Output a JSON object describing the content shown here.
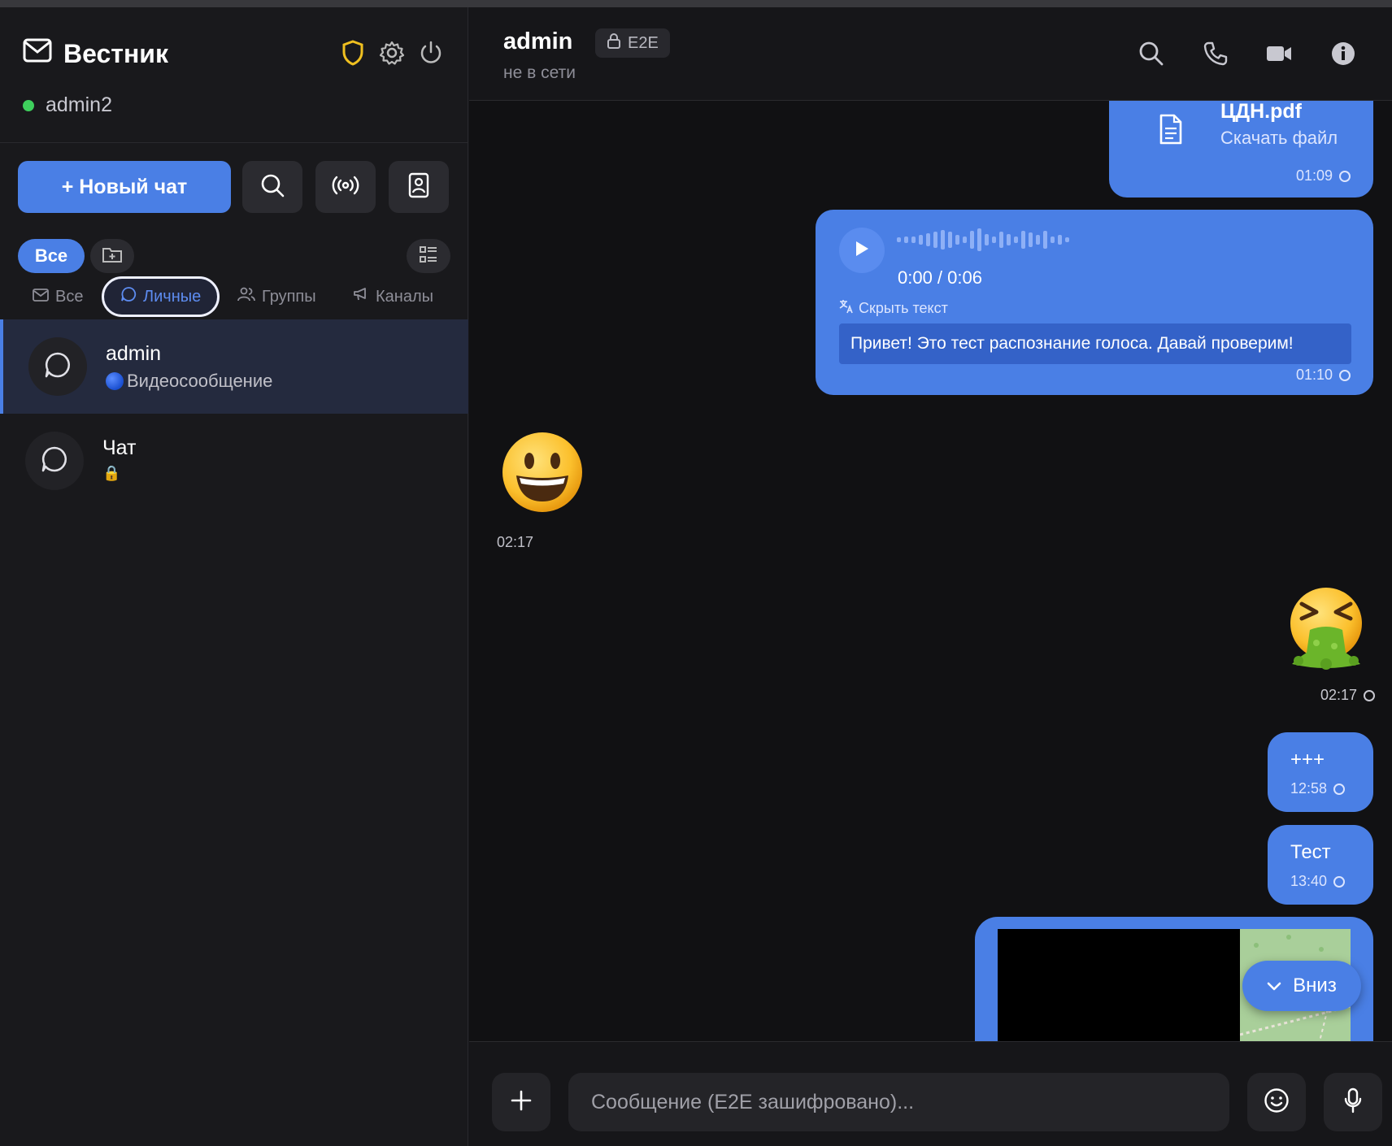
{
  "app": {
    "title": "Вестник",
    "user": "admin2"
  },
  "sidebar": {
    "new_chat": "+ Новый чат",
    "pill_all": "Все",
    "tabs": [
      {
        "label": "Все",
        "icon": "mail-icon"
      },
      {
        "label": "Личные",
        "icon": "chat-bubble-icon"
      },
      {
        "label": "Группы",
        "icon": "users-icon"
      },
      {
        "label": "Каналы",
        "icon": "megaphone-icon"
      }
    ],
    "chats": [
      {
        "name": "admin",
        "preview": "Видеосообщение",
        "preview_icon": "blue-circle-icon",
        "selected": true
      },
      {
        "name": "Чат",
        "preview": "🔒",
        "preview_icon": "lock-icon",
        "selected": false
      }
    ]
  },
  "chat": {
    "name": "admin",
    "badge": "E2E",
    "status": "не в сети",
    "messages": {
      "file": {
        "name": "ЦДН.pdf",
        "action": "Скачать файл",
        "time": "01:09"
      },
      "voice": {
        "progress": "0:00 / 0:06",
        "toggle": "Скрыть текст",
        "transcript": "Привет! Это тест распознание голоса. Давай проверим!",
        "time": "01:10"
      },
      "incoming_emoji": {
        "emoji": "😀",
        "time": "02:17"
      },
      "outgoing_emoji": {
        "emoji": "🤮",
        "time": "02:17"
      },
      "plus": {
        "text": "+++",
        "time": "12:58"
      },
      "test": {
        "text": "Тест",
        "time": "13:40"
      }
    },
    "scroll_down": "Вниз",
    "composer_placeholder": "Сообщение (E2E зашифровано)..."
  },
  "colors": {
    "accent": "#4a7fe5",
    "online": "#3ecf5c",
    "shield": "#f0c020"
  }
}
